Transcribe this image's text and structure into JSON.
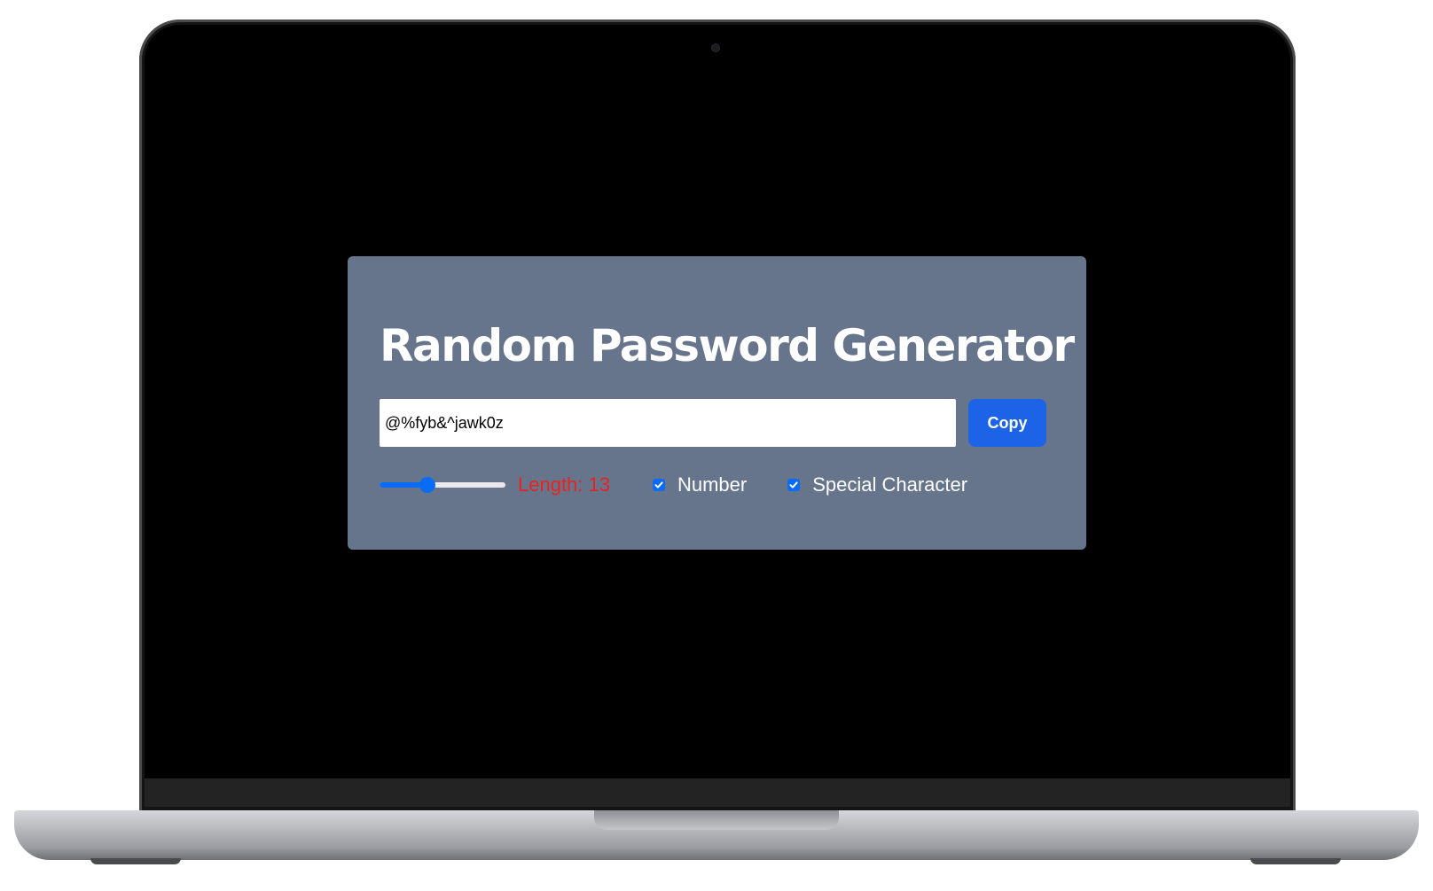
{
  "app": {
    "title": "Random Password Generator",
    "password": {
      "value": "@%fyb&^jawk0z"
    },
    "copy_button": {
      "label": "Copy"
    },
    "length": {
      "label": "Length: 13",
      "value": 13,
      "slider_fraction": 0.38
    },
    "options": [
      {
        "label": "Number",
        "checked": true,
        "icon": "check-icon"
      },
      {
        "label": "Special Character",
        "checked": true,
        "icon": "check-icon"
      }
    ]
  },
  "colors": {
    "card": "#66758c",
    "accent": "#1d63e8",
    "length_label": "#e8231e"
  }
}
